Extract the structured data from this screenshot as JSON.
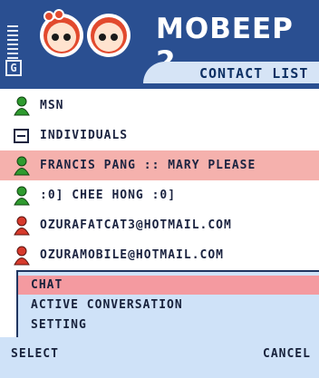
{
  "header": {
    "title": "MOBEEP 2",
    "subtitle": "CONTACT LIST",
    "network_badge": "G",
    "icons": [
      "signal-strength-icon",
      "mobeep-faces-logo"
    ]
  },
  "contacts": {
    "rows": [
      {
        "label": "MSN",
        "icon": "msn-user-icon-green",
        "selected": false
      },
      {
        "label": "INDIVIDUALS",
        "icon": "collapse-group-icon",
        "selected": false
      },
      {
        "label": "FRANCIS PANG :: MARY PLEASE",
        "icon": "msn-user-icon-green",
        "selected": true
      },
      {
        "label": ":0] CHEE HONG :0]",
        "icon": "msn-user-icon-green",
        "selected": false
      },
      {
        "label": "OZURAFATCAT3@HOTMAIL.COM",
        "icon": "msn-user-icon-red",
        "selected": false
      },
      {
        "label": "OZURAMOBILE@HOTMAIL.COM",
        "icon": "msn-user-icon-red",
        "selected": false
      }
    ]
  },
  "menu": {
    "items": [
      {
        "label": "CHAT",
        "highlighted": true
      },
      {
        "label": "ACTIVE CONVERSATION",
        "highlighted": false
      },
      {
        "label": "SETTING",
        "highlighted": false
      }
    ]
  },
  "softkeys": {
    "left": "SELECT",
    "right": "CANCEL"
  },
  "colors": {
    "header_bg": "#2a4f91",
    "selection": "#f5b1ad",
    "menu_bg": "#cfe2f8",
    "menu_highlight": "#f49aa0",
    "online": "#2f9b2f",
    "offline": "#d63a2c"
  }
}
